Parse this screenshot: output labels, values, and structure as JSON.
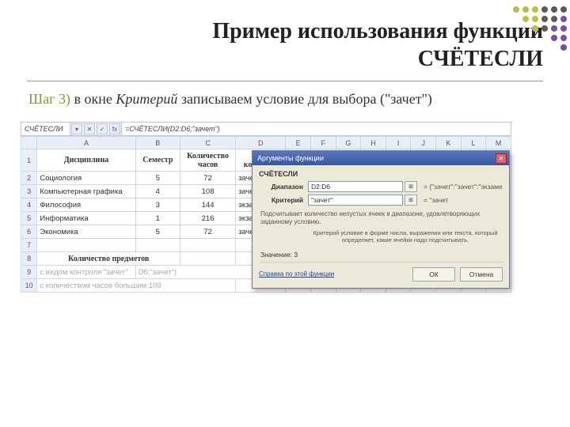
{
  "title_line1": "Пример использования функции",
  "title_line2": "СЧЁТЕСЛИ",
  "step_prefix": "Шаг 3)",
  "step_text_a": " в окне ",
  "step_italic": "Критерий",
  "step_text_b": " записываем условие для выбора (\"зачет\")",
  "formula_bar": {
    "namebox": "СЧЁТЕСЛИ",
    "formula": "=СЧЁТЕСЛИ(D2:D6;\"зачет\")"
  },
  "columns": [
    "A",
    "B",
    "C",
    "D",
    "E",
    "F",
    "G",
    "H",
    "I",
    "J",
    "K",
    "L",
    "M"
  ],
  "headers": {
    "A": "Дисциплина",
    "B": "Семестр",
    "C": "Количество часов",
    "D": "Вид контроля"
  },
  "rows": [
    {
      "n": "2",
      "A": "Социология",
      "B": "5",
      "C": "72",
      "D": "зачет"
    },
    {
      "n": "3",
      "A": "Компьютерная графика",
      "B": "4",
      "C": "108",
      "D": "зачет"
    },
    {
      "n": "4",
      "A": "Философия",
      "B": "3",
      "C": "144",
      "D": "экзамен"
    },
    {
      "n": "5",
      "A": "Информатика",
      "B": "1",
      "C": "216",
      "D": "экзамен"
    },
    {
      "n": "6",
      "A": "Экономика",
      "B": "5",
      "C": "72",
      "D": "зачет"
    }
  ],
  "row7": "",
  "row8_label": "Количество предметов",
  "row9_a": "с видом контроля \"зачет\"",
  "row9_b_frag": "D6;\"зачет\")",
  "row10_a": "с количеством часов большим 100",
  "dialog": {
    "title": "Аргументы функции",
    "func": "СЧЁТЕСЛИ",
    "l_range": "Диапазон",
    "v_range": "D2:D6",
    "e_range": "= {\"зачет\":\"зачет\":\"экзамен\":\"экзам...",
    "l_crit": "Критерий",
    "v_crit": "\"зачет\"",
    "e_crit": "= \"зачет",
    "desc": "Подсчитывает количество непустых ячеек в диапазоне, удовлетворяющих заданному условию.",
    "sub": "Критерий  условие в форме числа, выражения или текста, который определяет, какие ячейки надо подсчитывать.",
    "result": "Значение: 3",
    "help": "Справка по этой функции",
    "ok": "ОК",
    "cancel": "Отмена"
  }
}
